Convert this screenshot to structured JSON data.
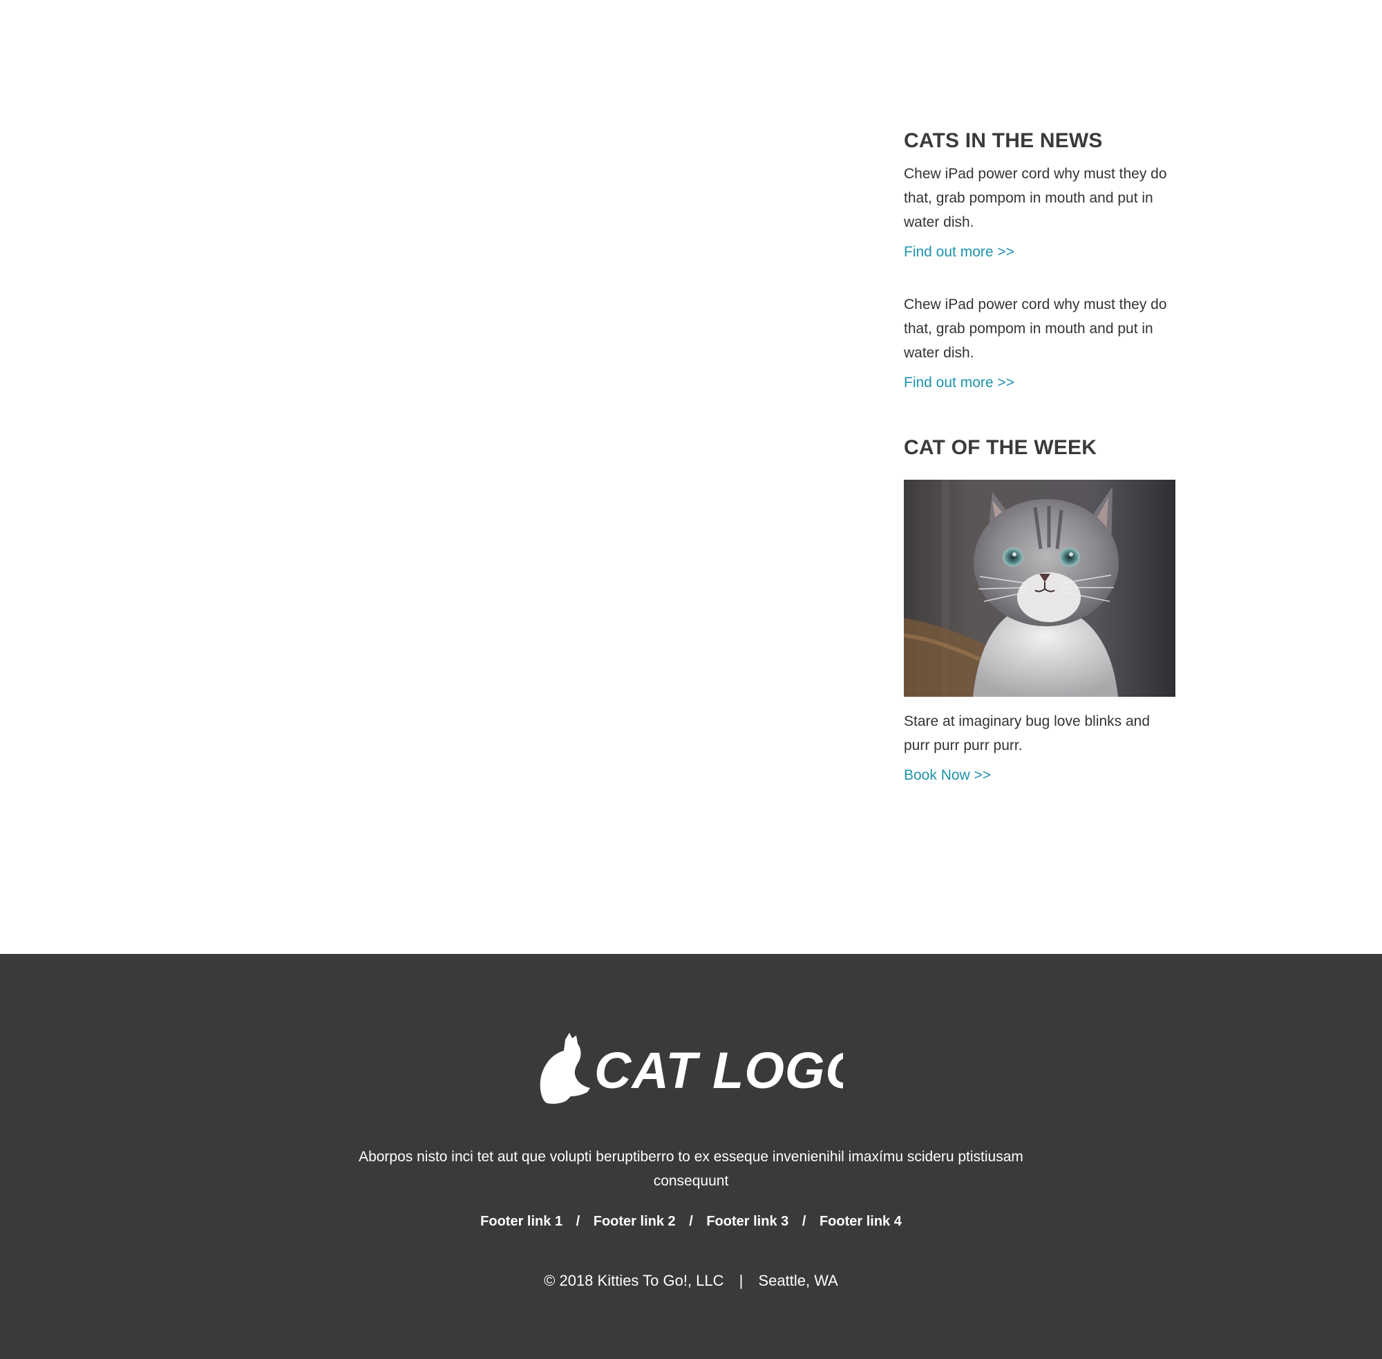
{
  "sidebar": {
    "news_title": "CATS IN THE NEWS",
    "news_items": [
      {
        "text": "Chew iPad power cord why must they do that, grab pompom in mouth and put in water dish.",
        "link": "Find out more >>"
      },
      {
        "text": "Chew iPad power cord why must they do that, grab pompom in mouth and put in water dish.",
        "link": "Find out more >>"
      }
    ],
    "cotw_title": "CAT OF THE WEEK",
    "cotw_text": "Stare at imaginary bug love blinks and purr purr purr purr.",
    "cotw_link": "Book Now >>",
    "cotw_photo": "kitten-photo"
  },
  "footer": {
    "logo_text": "CAT LOGO",
    "description": "Aborpos nisto inci tet aut que volupti beruptiberro to ex esseque invenienihil imaxímu scideru ptistiusam consequunt",
    "links": [
      "Footer link 1",
      "Footer link 2",
      "Footer link 3",
      "Footer link 4"
    ],
    "link_separator": "/",
    "copyright": "© 2018 Kitties To Go!, LLC",
    "copy_separator": "|",
    "location": "Seattle, WA"
  },
  "colors": {
    "link": "#1f93ad",
    "heading": "#3a3a3a",
    "footer_bg": "#3a3a3a",
    "footer_text": "#ffffff"
  }
}
